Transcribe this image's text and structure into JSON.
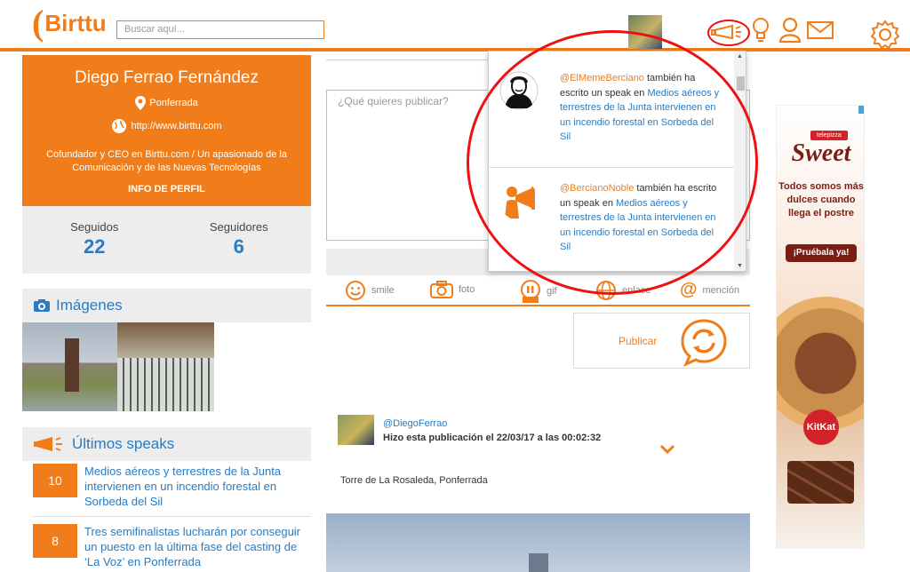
{
  "header": {
    "logo_text": "Birttu",
    "logo_rest": "irttu",
    "search_placeholder": "Buscar aquí..."
  },
  "profile": {
    "name": "Diego Ferrao Fernández",
    "location": "Ponferrada",
    "website": "http://www.birttu.com",
    "bio": "Cofundador y CEO en Birttu.com / Un apasionado de la Comunicación y de las Nuevas Tecnologías",
    "info_link": "INFO DE PERFIL",
    "stats": [
      {
        "label": "Seguidos",
        "value": "22"
      },
      {
        "label": "Seguidores",
        "value": "6"
      }
    ]
  },
  "images_panel": {
    "title": "Imágenes"
  },
  "speaks_panel": {
    "title": "Últimos speaks",
    "items": [
      {
        "count": "10",
        "title": "Medios aéreos y terrestres de la Junta intervienen en un incendio forestal en Sorbeda del Sil"
      },
      {
        "count": "8",
        "title": "Tres semifinalistas lucharán por conseguir un puesto en la última fase del casting de ‘La Voz’ en Ponferrada"
      }
    ]
  },
  "composer": {
    "placeholder": "¿Qué quieres publicar?",
    "tools": [
      {
        "label": "smile",
        "icon": "smile-icon"
      },
      {
        "label": "foto",
        "icon": "camera-icon"
      },
      {
        "label": "gif",
        "icon": "gif-icon"
      },
      {
        "label": "enlace",
        "icon": "globe-icon"
      },
      {
        "label": "mención",
        "icon": "at-icon"
      }
    ],
    "publish_label": "Publicar"
  },
  "post": {
    "user": "@DiegoFerrao",
    "meta": "Hizo esta publicación el 22/03/17 a las 00:02:32",
    "text": "Torre de La Rosaleda, Ponferrada"
  },
  "notifications": [
    {
      "user": "@ElMemeBerciano",
      "verb": " también ha escrito un speak en ",
      "title": "Medios aéreos y terrestres de la Junta intervienen en un incendio forestal en Sorbeda del Sil",
      "avatar": "anonymous-mask-icon"
    },
    {
      "user": "@BercianoNoble",
      "verb": " también ha escrito un speak en ",
      "title": "Medios aéreos y terrestres de la Junta intervienen en un incendio forestal en Sorbeda del Sil",
      "avatar": "megaphone-man-icon"
    }
  ],
  "ad": {
    "brand": "telepizza",
    "headline": "Sweet",
    "tagline": "Todos somos más dulces cuando llega el postre",
    "cta": "¡Pruébala ya!",
    "partner": "KitKat"
  },
  "colors": {
    "accent": "#f07d1a",
    "link": "#2a7bc1",
    "highlight_circle": "#e11111"
  }
}
